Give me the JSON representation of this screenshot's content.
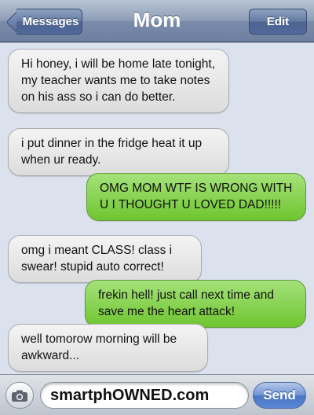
{
  "navbar": {
    "title": "Mom",
    "back_label": "Messages",
    "edit_label": "Edit"
  },
  "messages": [
    {
      "direction": "in",
      "text": "Hi honey, i will be home late tonight, my teacher wants me to take notes on his ass so i can do better."
    },
    {
      "direction": "in",
      "text": "i put dinner in the fridge heat it up when ur ready."
    },
    {
      "direction": "out",
      "text": "OMG MOM WTF IS WRONG WITH U I THOUGHT U LOVED DAD!!!!!"
    },
    {
      "direction": "in",
      "text": "omg i meant CLASS! class i swear! stupid auto correct!"
    },
    {
      "direction": "out",
      "text": "frekin hell! just call next time and save me the heart attack!"
    },
    {
      "direction": "in",
      "text": "well tomorow morning will be awkward..."
    }
  ],
  "compose": {
    "field_value": "smartphOWNED.com",
    "send_label": "Send",
    "camera_icon": "camera-icon"
  },
  "colors": {
    "incoming_bubble": "#e6e6e6",
    "outgoing_bubble": "#86d44a",
    "navbar": "#7b8cab",
    "send_button": "#5b86d3"
  }
}
